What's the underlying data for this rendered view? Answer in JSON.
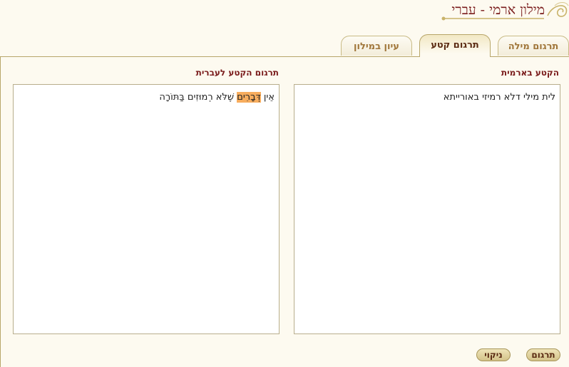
{
  "app": {
    "logo_text": "מילון ארמי - עברי"
  },
  "tabs": [
    {
      "label": "תרגום מילה"
    },
    {
      "label": "תרגום קטע",
      "active": true
    },
    {
      "label": "עיון במילון"
    }
  ],
  "source": {
    "title": "הקטע בארמית",
    "text": "לית מילי דלא רמיזי באורייתא"
  },
  "result": {
    "title": "תרגום הקטע לעברית",
    "before": "אֵין ",
    "highlight": "דְּבָרִים",
    "after": " שֶׁלֹּא רְמוּזִים בַּתּוֹרָה"
  },
  "buttons": {
    "translate": "תרגום",
    "clear": "ניקוי"
  },
  "colors": {
    "accent": "#7a1c1c",
    "background": "#fdfaf0",
    "highlight": "#f7ad5e",
    "border": "#b8a66a"
  }
}
